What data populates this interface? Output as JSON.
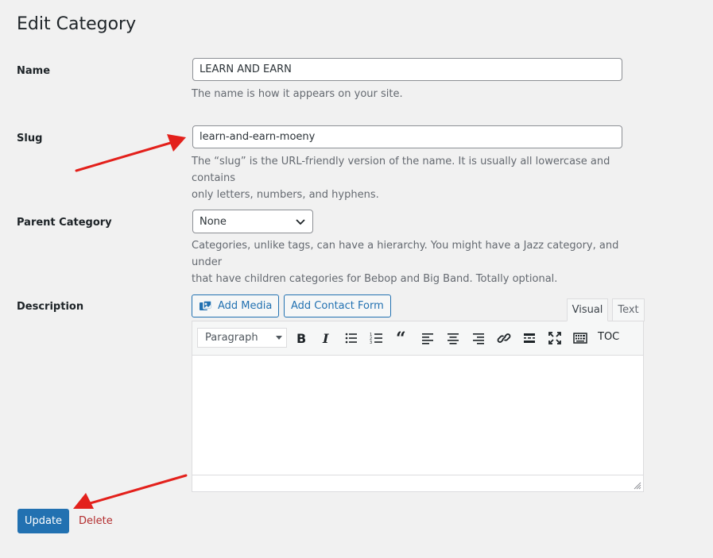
{
  "page_title": "Edit Category",
  "name_field": {
    "label": "Name",
    "value": "LEARN AND EARN",
    "help": "The name is how it appears on your site."
  },
  "slug_field": {
    "label": "Slug",
    "value": "learn-and-earn-moeny",
    "help_line1": "The “slug” is the URL-friendly version of the name. It is usually all lowercase and contains",
    "help_line2": "only letters, numbers, and hyphens."
  },
  "parent_field": {
    "label": "Parent Category",
    "selected": "None",
    "help_line1": "Categories, unlike tags, can have a hierarchy. You might have a Jazz category, and under",
    "help_line2": "that have children categories for Bebop and Big Band. Totally optional."
  },
  "description_field": {
    "label": "Description",
    "add_media_label": "Add Media",
    "add_contact_form_label": "Add Contact Form",
    "tab_visual": "Visual",
    "tab_text": "Text",
    "format_select": "Paragraph",
    "toc_label": "TOC",
    "toolbar_icons": [
      "bold-icon",
      "italic-icon",
      "bullet-list-icon",
      "numbered-list-icon",
      "blockquote-icon",
      "align-left-icon",
      "align-center-icon",
      "align-right-icon",
      "link-icon",
      "read-more-icon",
      "fullscreen-icon",
      "toolbar-toggle-icon"
    ]
  },
  "actions": {
    "update_label": "Update",
    "delete_label": "Delete"
  },
  "colors": {
    "primary": "#2271b1",
    "delete": "#b32d2e",
    "arrow": "#e3201b",
    "background": "#f1f1f1"
  }
}
